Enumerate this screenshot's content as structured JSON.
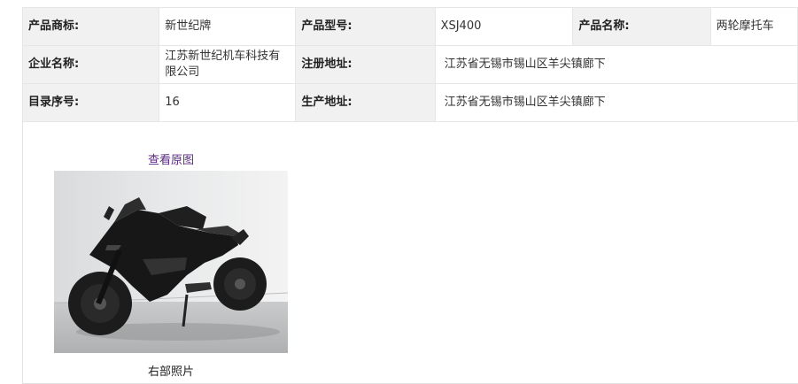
{
  "table": {
    "row1": {
      "brand_label": "产品商标:",
      "brand_value": "新世纪牌",
      "model_label": "产品型号:",
      "model_value": "XSJ400",
      "name_label": "产品名称:",
      "name_value": "两轮摩托车"
    },
    "row2": {
      "company_label": "企业名称:",
      "company_value": "江苏新世纪机车科技有限公司",
      "reg_addr_label": "注册地址:",
      "reg_addr_value": "江苏省无锡市锡山区羊尖镇廊下"
    },
    "row3": {
      "catalog_label": "目录序号:",
      "catalog_value": "16",
      "prod_addr_label": "生产地址:",
      "prod_addr_value": "江苏省无锡市锡山区羊尖镇廊下"
    }
  },
  "photo": {
    "view_original_link": "查看原图",
    "caption": "右部照片"
  }
}
